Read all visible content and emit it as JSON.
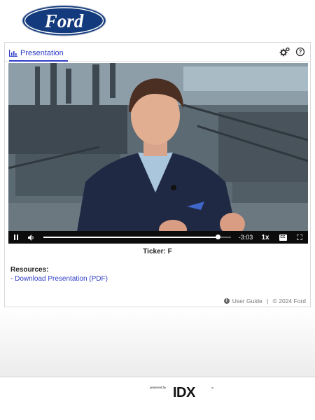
{
  "brand": {
    "logo_text": "Ford",
    "logo_color": "#133a7c"
  },
  "tabs": [
    {
      "label": "Presentation",
      "icon": "bar-chart-icon",
      "active": true
    }
  ],
  "toolbar": {
    "settings_icon": "gears-icon",
    "help_icon": "question-circle-icon"
  },
  "player": {
    "time_remaining": "-3:03",
    "speed": "1x",
    "progress": 0.93,
    "icons": [
      "pause-icon",
      "volume-icon",
      "closed-caption-icon",
      "fullscreen-icon"
    ]
  },
  "ticker": {
    "label": "Ticker: F"
  },
  "resources": {
    "title": "Resources:",
    "items": [
      {
        "label": "- Download Presentation (PDF)"
      }
    ]
  },
  "footer": {
    "user_guide": "User Guide",
    "separator": " | ",
    "copyright": "© 2024 Ford"
  },
  "powered_by": {
    "label": "powered by",
    "brand": "IDX",
    "tm": "™"
  },
  "colors": {
    "accent": "#2f3ec7",
    "ford_blue": "#133a7c"
  }
}
